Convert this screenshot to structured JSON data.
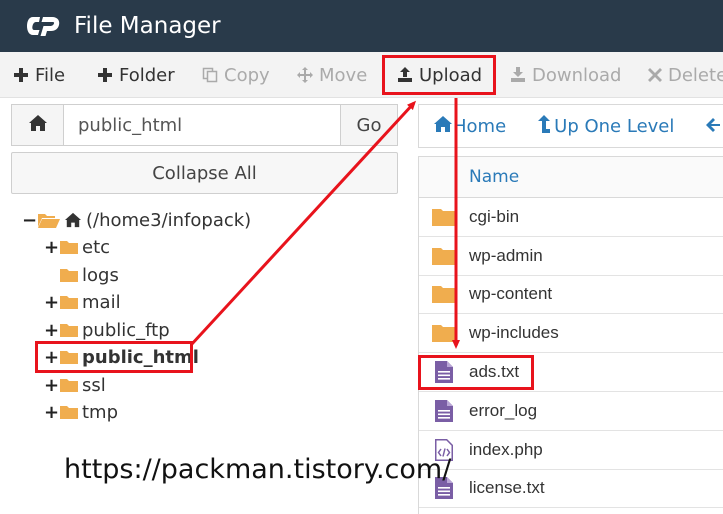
{
  "header": {
    "title": "File Manager",
    "logo_icon": "cpanel-logo-icon",
    "bg_color": "#293a4a"
  },
  "toolbar": {
    "file": "File",
    "folder": "Folder",
    "copy": "Copy",
    "move": "Move",
    "upload": "Upload",
    "download": "Download",
    "delete": "Delete"
  },
  "address_bar": {
    "value": "public_html",
    "go": "Go"
  },
  "tree": {
    "collapse_all": "Collapse All",
    "root": "(/home3/infopack)",
    "items": [
      {
        "label": "etc",
        "expandable": true
      },
      {
        "label": "logs",
        "expandable": false
      },
      {
        "label": "mail",
        "expandable": true
      },
      {
        "label": "public_ftp",
        "expandable": true
      },
      {
        "label": "public_html",
        "expandable": true,
        "selected": true
      },
      {
        "label": "ssl",
        "expandable": true
      },
      {
        "label": "tmp",
        "expandable": true
      }
    ]
  },
  "nav": {
    "home": "Home",
    "up_one_level": "Up One Level",
    "back": "B"
  },
  "file_table": {
    "name_header": "Name",
    "files": [
      {
        "name": "cgi-bin",
        "type": "folder"
      },
      {
        "name": "wp-admin",
        "type": "folder"
      },
      {
        "name": "wp-content",
        "type": "folder"
      },
      {
        "name": "wp-includes",
        "type": "folder"
      },
      {
        "name": "ads.txt",
        "type": "text-file"
      },
      {
        "name": "error_log",
        "type": "text-file"
      },
      {
        "name": "index.php",
        "type": "code-file"
      },
      {
        "name": "license.txt",
        "type": "text-file"
      }
    ]
  },
  "watermark": "https://packman.tistory.com/",
  "colors": {
    "link": "#2a7ab8",
    "folder": "#f0ad4e",
    "file_icon": "#7a5ea5",
    "highlight": "#e8131c"
  }
}
